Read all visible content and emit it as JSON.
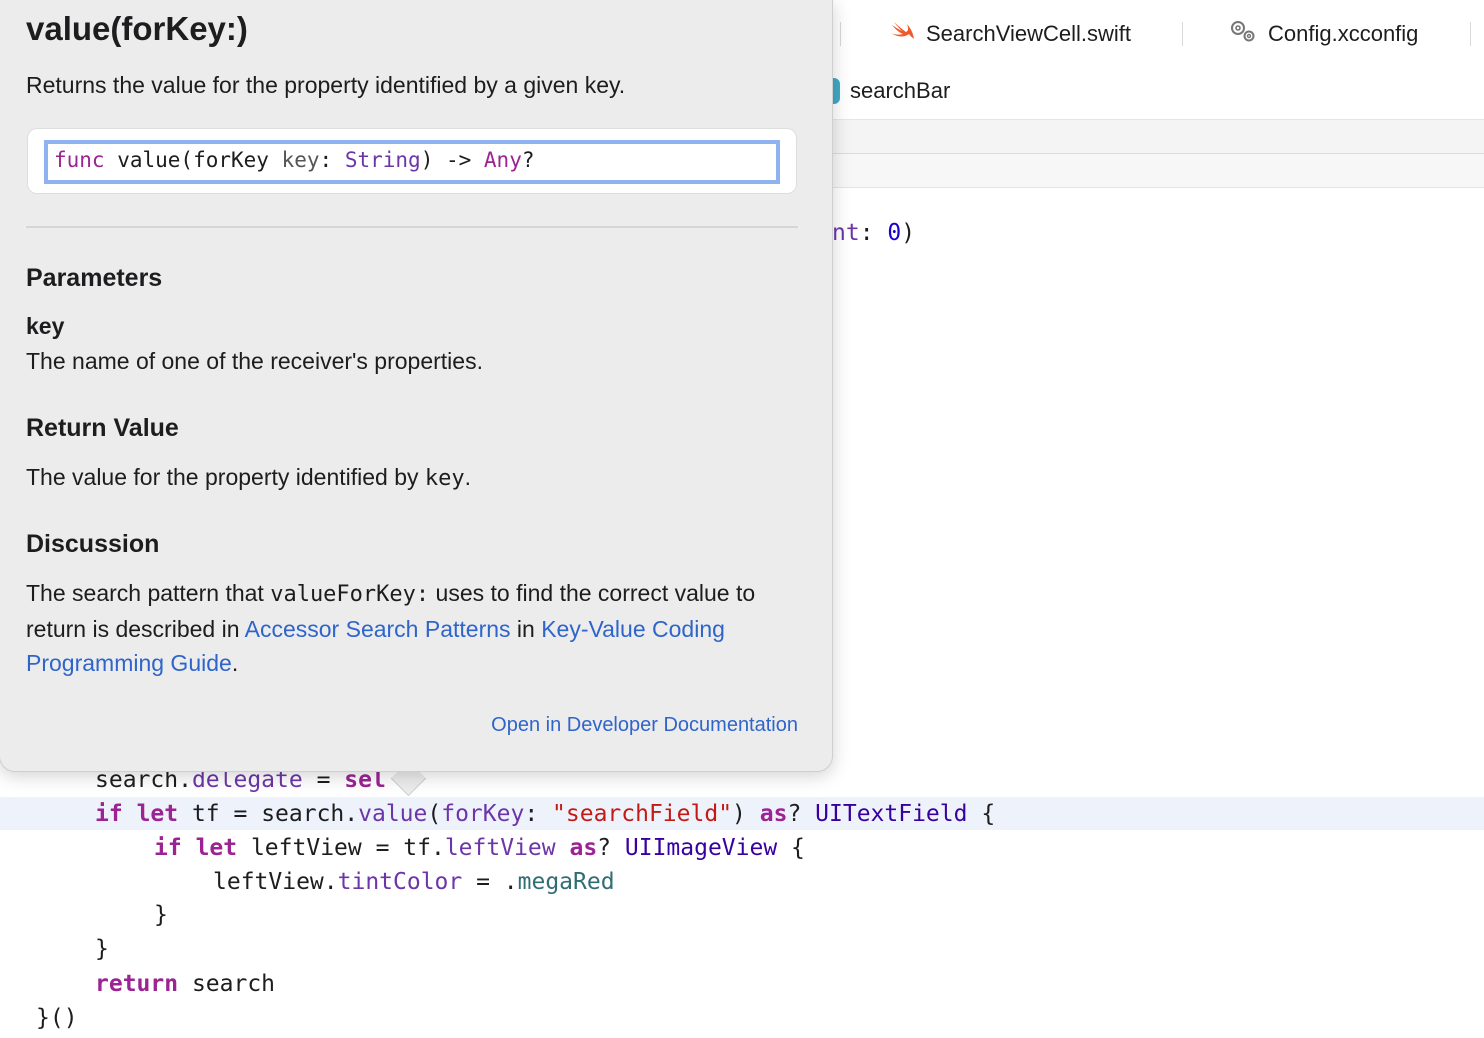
{
  "tabs": [
    {
      "label": "SearchViewCell.swift",
      "icon": "swift-file-icon"
    },
    {
      "label": "Config.xcconfig",
      "icon": "gear-config-icon"
    }
  ],
  "jump_bar": {
    "item": "searchBar"
  },
  "editor": {
    "partial_line": {
      "t1": "nt",
      "t2": ": ",
      "t3": "0",
      "t4": ")"
    },
    "line_delegate": {
      "a": "search.",
      "b": "delegate",
      "c": " = ",
      "d": "sel"
    },
    "line_if_tf": {
      "kw1": "if",
      "kw2": "let",
      "a": " tf = search.",
      "b": "value",
      "c": "(",
      "d": "forKey",
      "e": ": ",
      "f": "\"searchField\"",
      "g": ") ",
      "h": "as",
      "i": "? ",
      "j": "UITextField",
      "k": " {"
    },
    "line_if_left": {
      "kw1": "if",
      "kw2": "let",
      "a": " leftView = tf.",
      "b": "leftView",
      "c": " ",
      "d": "as",
      "e": "? ",
      "f": "UIImageView",
      "g": " {"
    },
    "line_tint": {
      "a": "leftView.",
      "b": "tintColor",
      "c": " = .",
      "d": "megaRed"
    },
    "close_inner": "}",
    "close_outer": "}",
    "line_return": {
      "kw": "return",
      "a": " search"
    },
    "line_end": "}()"
  },
  "quick_help": {
    "title": "value(forKey:)",
    "abstract": "Returns the value for the property identified by a given key.",
    "declaration": {
      "kw": "func",
      "name": " value(forKey ",
      "param": "key",
      "colon": ": ",
      "type": "String",
      "arrow": ") -> ",
      "ret": "Any",
      "opt": "?"
    },
    "parameters_heading": "Parameters",
    "param_name": "key",
    "param_desc": "The name of one of the receiver's properties.",
    "return_heading": "Return Value",
    "return_text_a": "The value for the property identified by ",
    "return_text_code": "key",
    "return_text_b": ".",
    "discussion_heading": "Discussion",
    "discussion_a": "The search pattern that ",
    "discussion_code": "valueForKey:",
    "discussion_b": " uses to find the correct value to return is described in ",
    "discussion_link1": "Accessor Search Patterns",
    "discussion_c": " in ",
    "discussion_link2": "Key-Value Coding Programming Guide",
    "discussion_d": ".",
    "open_docs": "Open in Developer Documentation"
  },
  "colors": {
    "keyword": "#9b2393",
    "string": "#c41a16",
    "type": "#3900a0",
    "link": "#2f65ca",
    "highlight": "#eef3fb"
  }
}
